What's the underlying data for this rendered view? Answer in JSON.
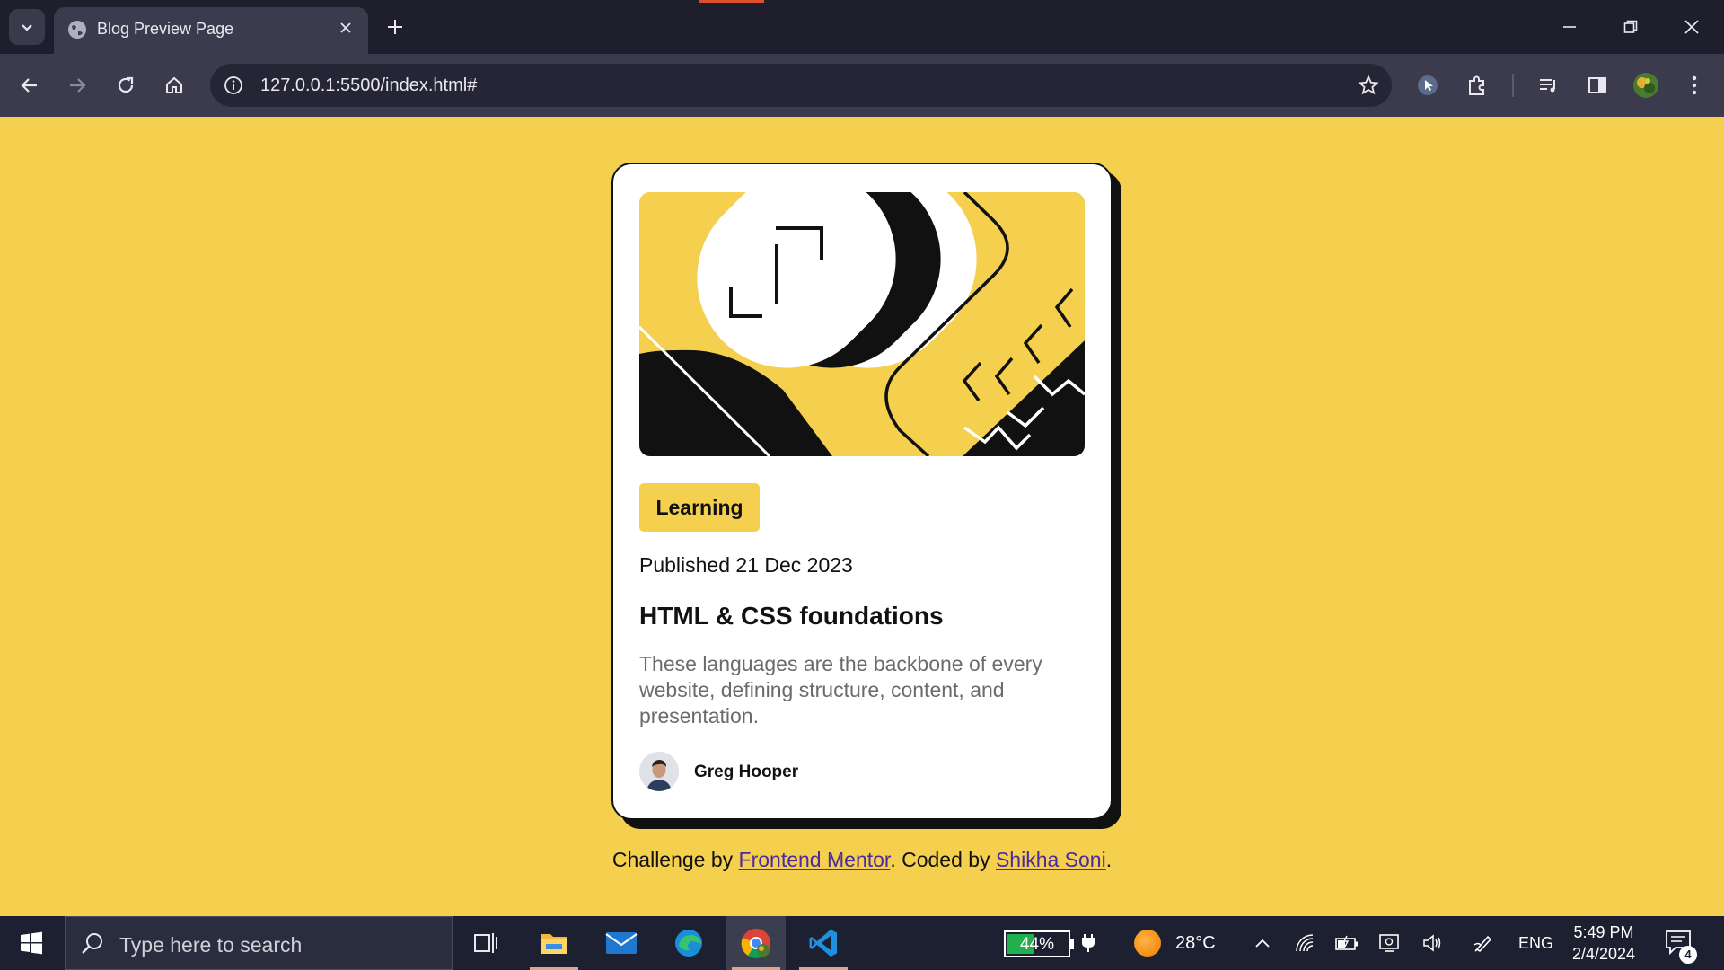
{
  "browser": {
    "tab_title": "Blog Preview Page",
    "url": "127.0.0.1:5500/index.html#"
  },
  "card": {
    "tag": "Learning",
    "published": "Published 21 Dec 2023",
    "title": "HTML & CSS foundations",
    "description": "These languages are the backbone of every website, defining structure, content, and presentation.",
    "author": "Greg Hooper"
  },
  "attribution": {
    "prefix": "Challenge by ",
    "link1": "Frontend Mentor",
    "middle": ". Coded by ",
    "link2": "Shikha Soni",
    "suffix": "."
  },
  "taskbar": {
    "search_placeholder": "Type here to search",
    "battery": "44%",
    "battery_level": 0.44,
    "temperature": "28°C",
    "language": "ENG",
    "time": "5:49 PM",
    "date": "2/4/2024",
    "notifications": "4"
  },
  "colors": {
    "page_bg": "#f4d04e",
    "chrome_bg": "#3b3b4d",
    "link": "#4a2aa0"
  }
}
